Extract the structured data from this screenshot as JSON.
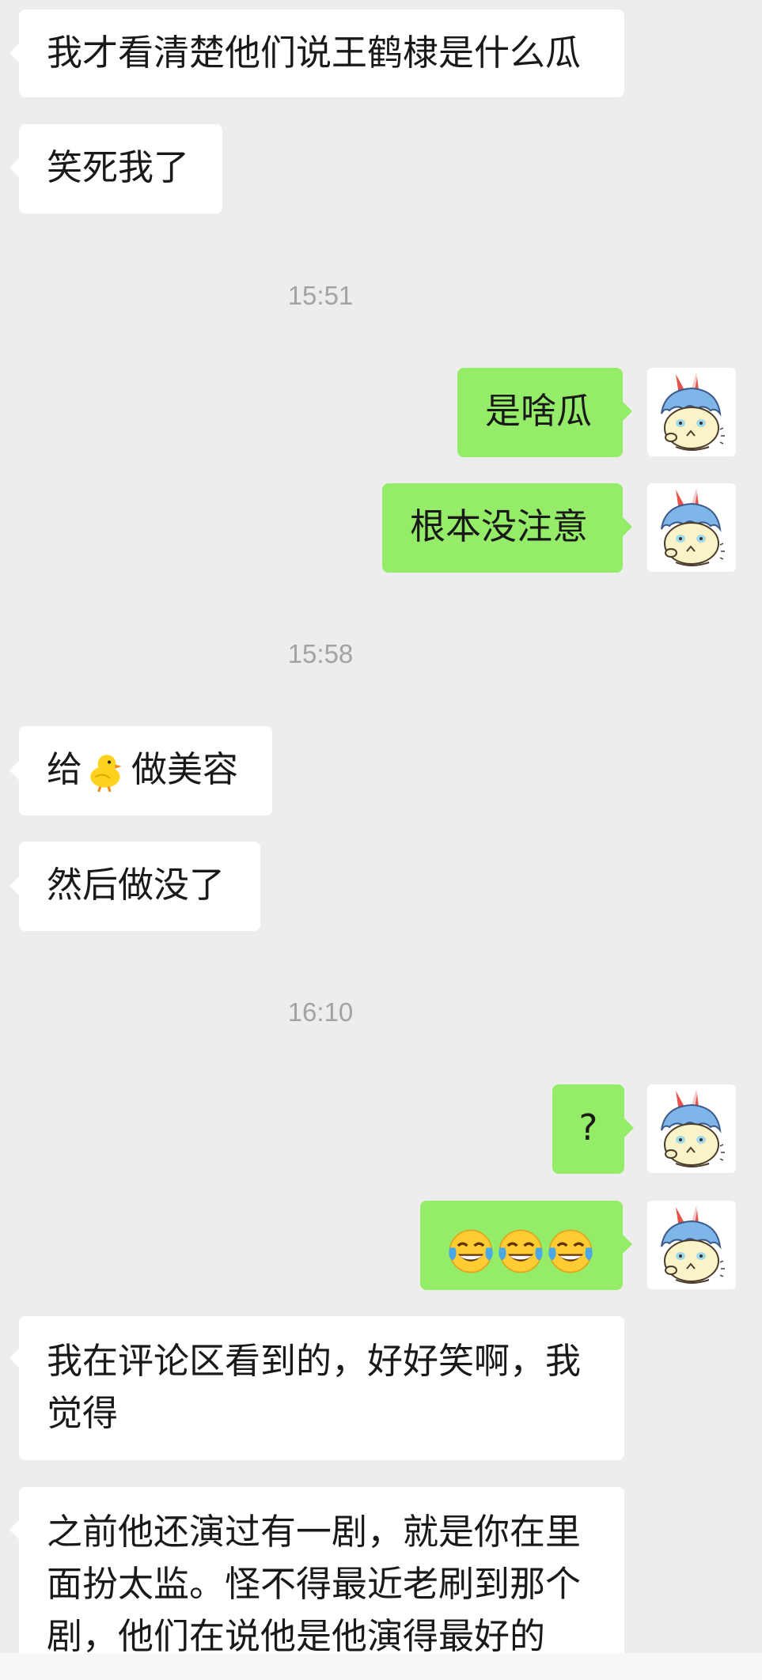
{
  "conversation": {
    "messages": [
      {
        "side": "in",
        "text": "我才看清楚他们说王鹤棣是什么瓜"
      },
      {
        "side": "in",
        "text": "笑死我了"
      },
      {
        "side": "out",
        "text": "是啥瓜"
      },
      {
        "side": "out",
        "text": "根本没注意"
      },
      {
        "side": "in",
        "text_before": "给",
        "emoji": "chick-emoji",
        "text_after": "做美容"
      },
      {
        "side": "in",
        "text": "然后做没了"
      },
      {
        "side": "out",
        "text": "?"
      },
      {
        "side": "out",
        "emoji": "tears-of-joy-emoji",
        "emoji_count": 3
      },
      {
        "side": "in",
        "text": "我在评论区看到的，好好笑啊，我觉得"
      },
      {
        "side": "in",
        "text": "之前他还演过有一剧，就是你在里面扮太监。怪不得最近老刷到那个剧，他们在说他是他演得最好的"
      }
    ],
    "timestamps": [
      "15:51",
      "15:58",
      "16:10"
    ]
  },
  "theme": {
    "background": "#ededed",
    "incoming_bubble": "#ffffff",
    "outgoing_bubble": "#95ec69",
    "timestamp_color": "#a3a3a3"
  },
  "avatar": {
    "icon": "bunny-mascot-avatar"
  }
}
